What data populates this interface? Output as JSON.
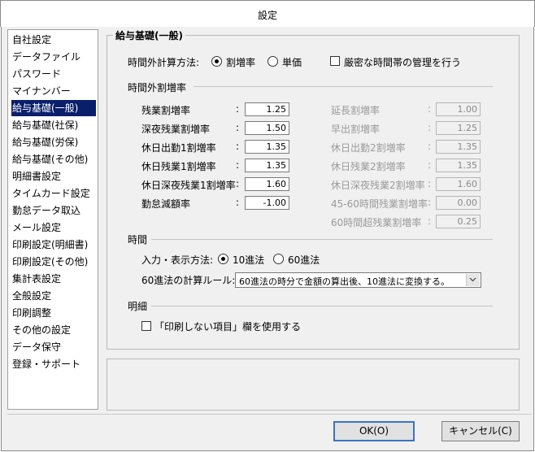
{
  "window": {
    "title": "設定"
  },
  "nav": {
    "items": [
      {
        "label": "自社設定"
      },
      {
        "label": "データファイル"
      },
      {
        "label": "パスワード"
      },
      {
        "label": "マイナンバー"
      },
      {
        "label": "給与基礎(一般)"
      },
      {
        "label": "給与基礎(社保)"
      },
      {
        "label": "給与基礎(労保)"
      },
      {
        "label": "給与基礎(その他)"
      },
      {
        "label": "明細書設定"
      },
      {
        "label": "タイムカード設定"
      },
      {
        "label": "勤怠データ取込"
      },
      {
        "label": "メール設定"
      },
      {
        "label": "印刷設定(明細書)"
      },
      {
        "label": "印刷設定(その他)"
      },
      {
        "label": "集計表設定"
      },
      {
        "label": "全般設定"
      },
      {
        "label": "印刷調整"
      },
      {
        "label": "その他の設定"
      },
      {
        "label": "データ保守"
      },
      {
        "label": "登録・サポート"
      }
    ],
    "selected": "給与基礎(一般)"
  },
  "panel": {
    "title": "給与基礎(一般)",
    "calc_method": {
      "label": "時間外計算方法:",
      "option_rate": "割増率",
      "option_unit": "単価",
      "selected": "割増率",
      "strict_label": "厳密な時間帯の管理を行う",
      "strict_checked": false
    },
    "overtime": {
      "section_title": "時間外割増率",
      "colon": ":",
      "left": [
        {
          "label": "残業割増率",
          "value": "1.25"
        },
        {
          "label": "深夜残業割増率",
          "value": "1.50"
        },
        {
          "label": "休日出勤1割増率",
          "value": "1.35"
        },
        {
          "label": "休日残業1割増率",
          "value": "1.35"
        },
        {
          "label": "休日深夜残業1割増率",
          "value": "1.60"
        },
        {
          "label": "勤怠減額率",
          "value": "-1.00"
        }
      ],
      "right": [
        {
          "label": "延長割増率",
          "value": "1.00"
        },
        {
          "label": "早出割増率",
          "value": "1.25"
        },
        {
          "label": "休日出勤2割増率",
          "value": "1.35"
        },
        {
          "label": "休日残業2割増率",
          "value": "1.35"
        },
        {
          "label": "休日深夜残業2割増率",
          "value": "1.60"
        },
        {
          "label": "45-60時間残業割増率",
          "value": "0.00"
        },
        {
          "label": "60時間超残業割増率",
          "value": "0.25"
        }
      ]
    },
    "time": {
      "section_title": "時間",
      "input_label": "入力・表示方法:",
      "option_10": "10進法",
      "option_60": "60進法",
      "selected": "10進法",
      "rule_label": "60進法の計算ルール:",
      "rule_value": "60進法の時分で金額の算出後、10進法に変換する。"
    },
    "detail": {
      "section_title": "明細",
      "checkbox_label": "「印刷しない項目」欄を使用する",
      "checked": false
    }
  },
  "buttons": {
    "ok": "OK(O)",
    "cancel": "キャンセル(C)"
  },
  "colors": {
    "selection": "#0a1f6c",
    "ok_border": "#3a73c6"
  }
}
